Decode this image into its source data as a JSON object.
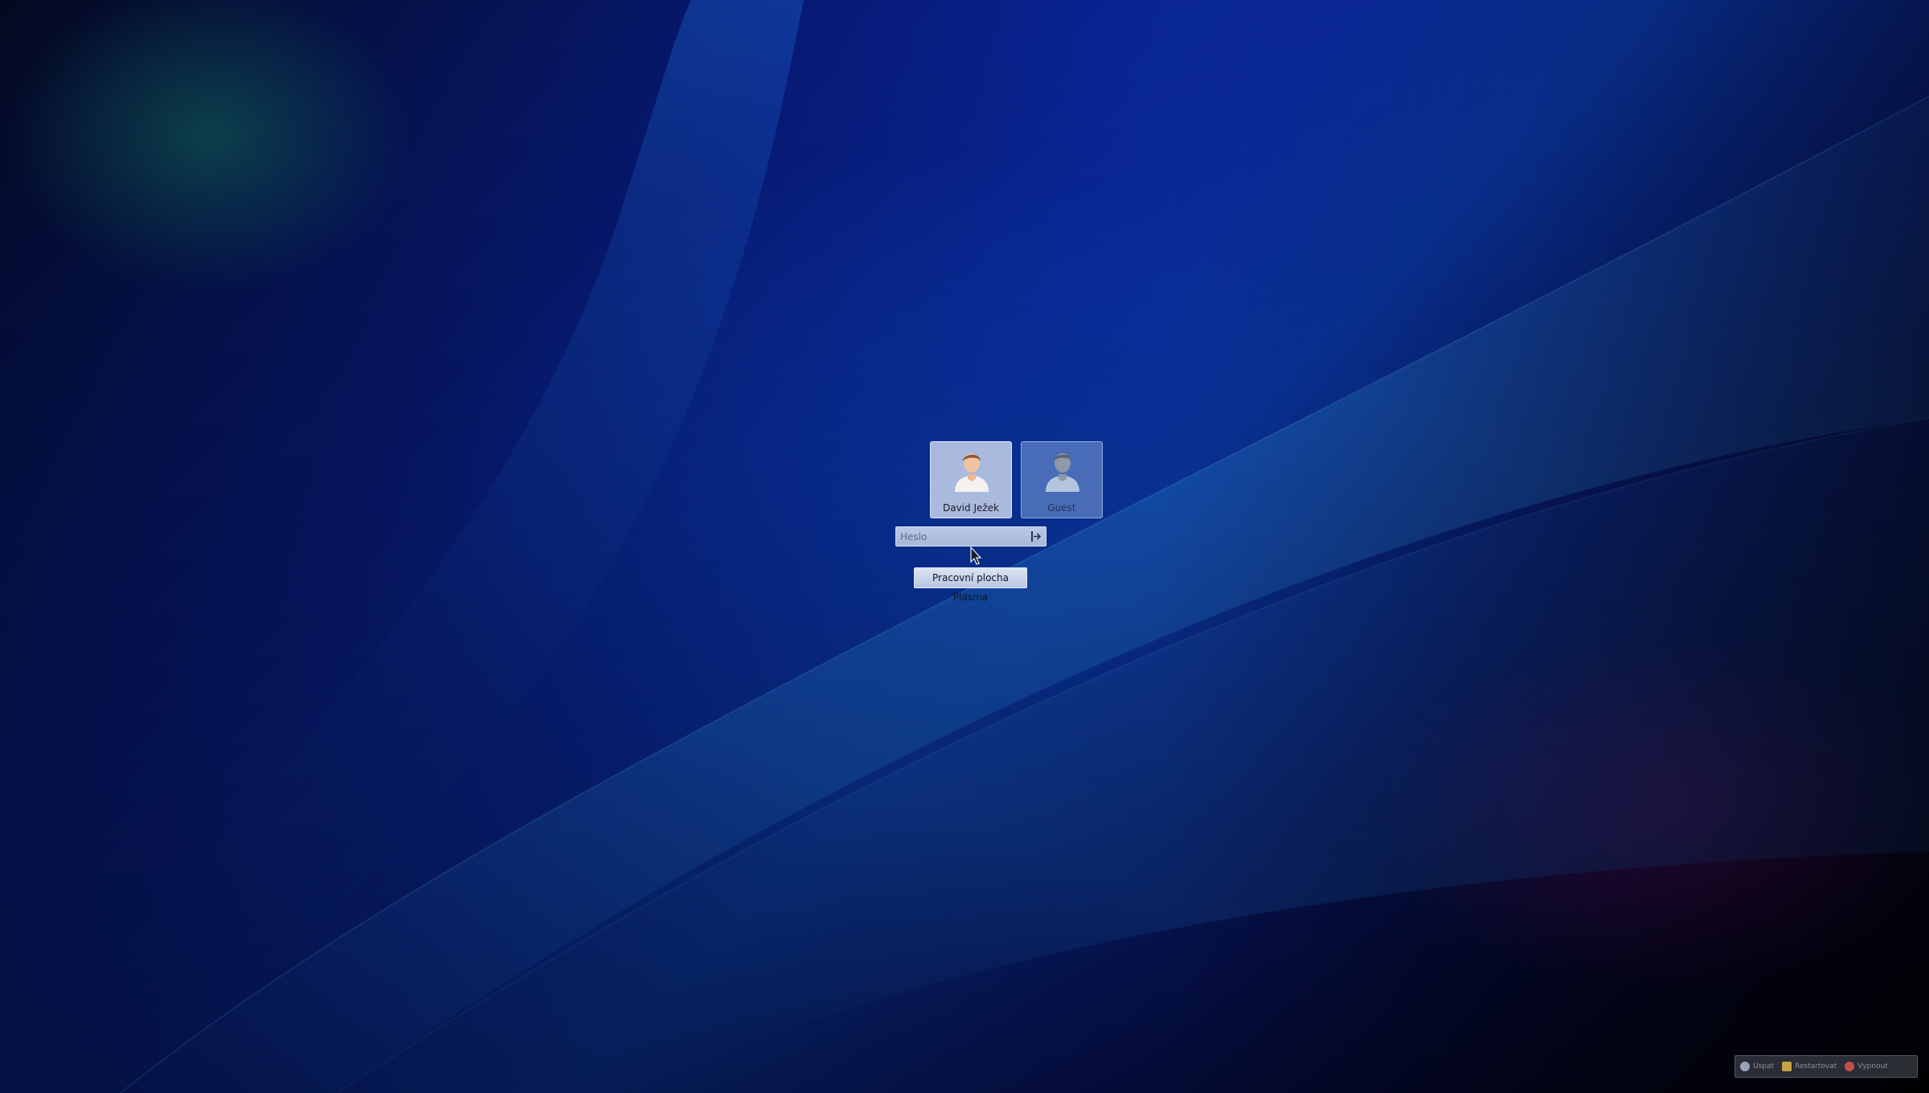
{
  "greeter": {
    "users": [
      {
        "name": "David Ježek",
        "selected": true
      },
      {
        "name": "Guest",
        "selected": false
      }
    ],
    "password": {
      "placeholder": "Heslo",
      "value": ""
    },
    "session_label": "Pracovní plocha Plasma"
  },
  "power_bar": {
    "items": [
      {
        "label": "Uspat",
        "icon": "suspend-icon"
      },
      {
        "label": "Restartovat",
        "icon": "restart-icon"
      },
      {
        "label": "Vypnout",
        "icon": "shutdown-icon"
      }
    ]
  },
  "colors": {
    "wallpaper_deep": "#071a78",
    "wallpaper_bright": "#0b3fbe",
    "glow_green": "#146e5a",
    "glow_magenta": "#a01496"
  }
}
